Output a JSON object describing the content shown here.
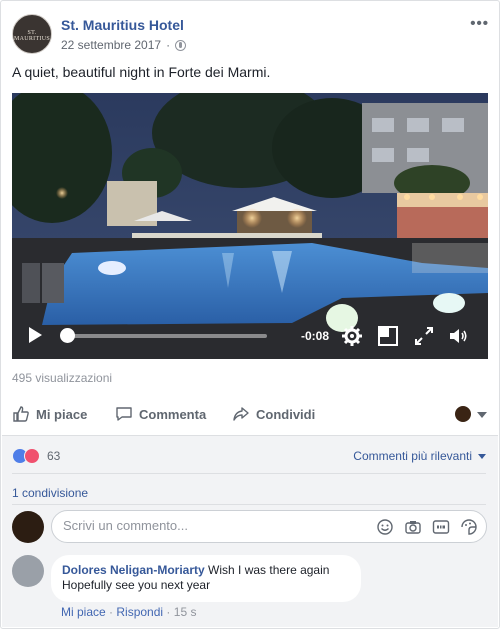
{
  "post": {
    "page_name": "St. Mauritius Hotel",
    "avatar_text": "ST. MAURITIUS",
    "date": "22 settembre 2017",
    "separator": "·",
    "more": "•••",
    "text": "A quiet, beautiful night in Forte dei Marmi.",
    "privacy_icon": "globe-icon"
  },
  "video": {
    "time_remaining": "-0:08",
    "progress": 0.02,
    "icons": [
      "play-icon",
      "settings-icon",
      "mini-player-icon",
      "fullscreen-icon",
      "volume-icon"
    ]
  },
  "stats": {
    "views": "495 visualizzazioni",
    "reaction_count": "63",
    "reaction_icons": [
      "like-icon",
      "love-icon"
    ],
    "shares": "1 condivisione"
  },
  "actions": {
    "like": "Mi piace",
    "comment": "Commenta",
    "share": "Condividi"
  },
  "comments": {
    "sort_label": "Commenti più rilevanti",
    "input_placeholder": "Scrivi un commento...",
    "input_icons": [
      "emoji-icon",
      "camera-icon",
      "gif-icon",
      "sticker-icon"
    ],
    "items": [
      {
        "author": "Dolores Neligan-Moriarty",
        "text": "Wish I was there again Hopefully see you next year",
        "like": "Mi piace",
        "reply": "Rispondi",
        "time": "15 s"
      }
    ]
  },
  "colors": {
    "link_blue": "#365899",
    "text_gray": "#606770",
    "like_blue": "#4f7ee8",
    "love_red": "#f0506e",
    "comment_bg": "#f2f3f5"
  }
}
